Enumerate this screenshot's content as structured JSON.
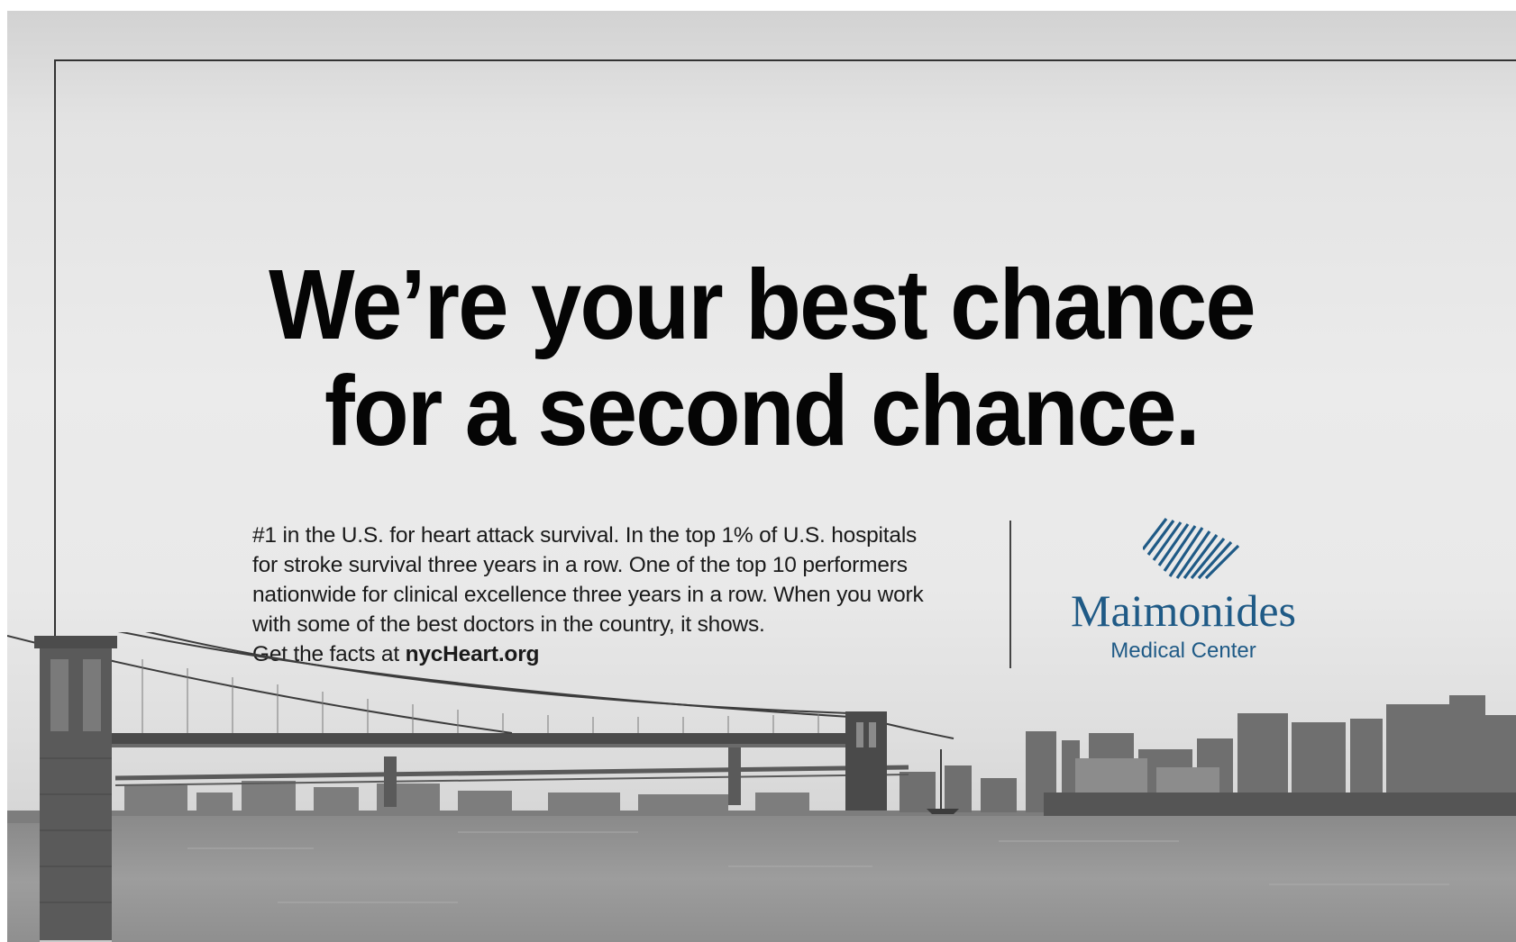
{
  "headline": {
    "line1": "We’re your best chance",
    "line2": "for a second chance."
  },
  "body": {
    "paragraph": "#1 in the U.S. for heart attack survival. In the top 1% of U.S. hospitals\nfor stroke survival three years in a row. One of the top 10 performers\nnationwide for clinical excellence three years in a row. When you work\nwith some of the best doctors in the country, it shows.",
    "cta_prefix": "Get the facts at ",
    "cta_link": "nycHeart.org"
  },
  "logo": {
    "name": "Maimonides",
    "subtitle": "Medical Center",
    "color": "#1f5a86"
  },
  "image": {
    "icon": "brooklyn-bridge-skyline-photo"
  }
}
